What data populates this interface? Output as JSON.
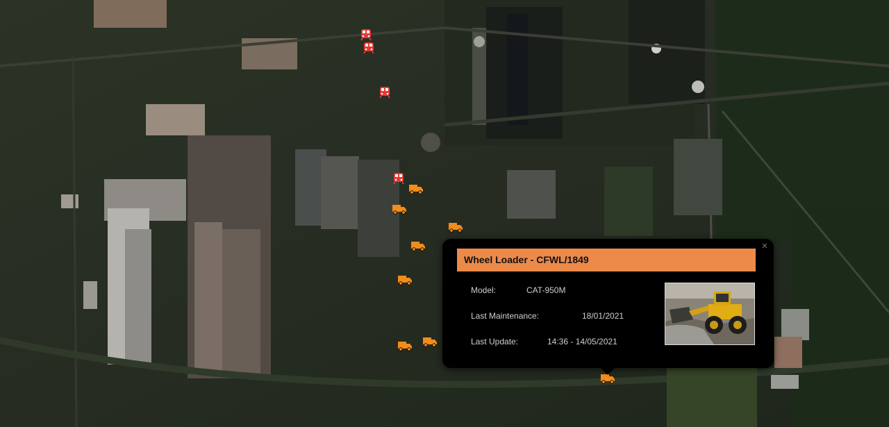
{
  "map": {
    "markers": {
      "rail": [
        {
          "id": "rail-1",
          "type": "rail",
          "value": "rail-marker"
        },
        {
          "id": "rail-2",
          "type": "rail",
          "value": "rail-marker"
        },
        {
          "id": "rail-3",
          "type": "rail",
          "value": "rail-marker"
        },
        {
          "id": "rail-4",
          "type": "rail",
          "value": "rail-marker"
        }
      ],
      "truck": [
        {
          "id": "truck-1",
          "type": "truck"
        },
        {
          "id": "truck-2",
          "type": "truck"
        },
        {
          "id": "truck-3",
          "type": "truck"
        },
        {
          "id": "truck-4",
          "type": "truck"
        },
        {
          "id": "truck-5",
          "type": "truck"
        },
        {
          "id": "truck-6",
          "type": "truck"
        },
        {
          "id": "truck-7",
          "type": "truck"
        },
        {
          "id": "truck-8",
          "type": "truck"
        }
      ]
    },
    "colors": {
      "rail": "#e53935",
      "truck": "#f28c1d",
      "popup_header": "#ec8a4a"
    }
  },
  "popup": {
    "title": "Wheel Loader - CFWL/1849",
    "close_glyph": "×",
    "fields": [
      {
        "label": "Model:",
        "value": "CAT-950M"
      },
      {
        "label": "Last Maintenance:",
        "value": "18/01/2021"
      },
      {
        "label": "Last Update:",
        "value": "14:36 - 14/05/2021"
      }
    ],
    "thumbnail_icon": "wheel-loader-photo"
  }
}
